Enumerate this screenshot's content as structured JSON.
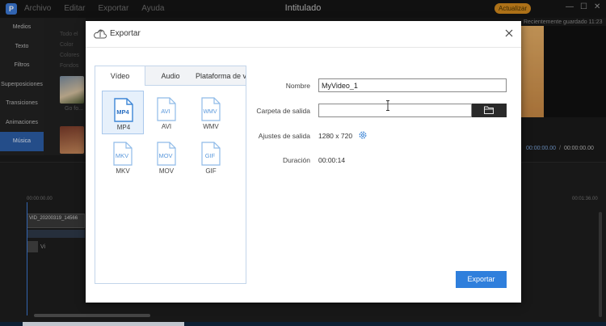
{
  "app": {
    "title": "Intitulado",
    "logo_letter": "P",
    "menu": [
      "Archivo",
      "Editar",
      "Exportar",
      "Ayuda"
    ],
    "upgrade_label": "Actualizar",
    "autosave": "Recientemente guardado 11:23",
    "timecode_current": "00:00:00.00",
    "timecode_sep": "/",
    "timecode_total": "00:00:00.00"
  },
  "sidebar": {
    "items": [
      {
        "label": "Medios"
      },
      {
        "label": "Texto"
      },
      {
        "label": "Filtros"
      },
      {
        "label": "Superposiciones"
      },
      {
        "label": "Transiciones"
      },
      {
        "label": "Animaciones"
      },
      {
        "label": "Música"
      }
    ],
    "media_lines": [
      "Todo el",
      "Color",
      "Colores",
      "Fondos"
    ],
    "thumb_label": "Go fo..."
  },
  "timeline": {
    "ruler_start": "00:00:00.00",
    "ruler_end": "00:01:36.00",
    "clip_name": "VID_20200319_14566",
    "track_label": "Vi"
  },
  "dialog": {
    "title": "Exportar",
    "tabs": {
      "video": "Vídeo",
      "audio": "Audio",
      "platform": "Plataforma de vídeo"
    },
    "formats": [
      {
        "label": "MP4",
        "selected": true
      },
      {
        "label": "AVI",
        "selected": false
      },
      {
        "label": "WMV",
        "selected": false
      },
      {
        "label": "MKV",
        "selected": false
      },
      {
        "label": "MOV",
        "selected": false
      },
      {
        "label": "GIF",
        "selected": false
      }
    ],
    "name": {
      "label": "Nombre",
      "value": "MyVideo_1"
    },
    "folder": {
      "label": "Carpeta de salida",
      "value": ""
    },
    "settings": {
      "label": "Ajustes de salida",
      "value": "1280 x 720"
    },
    "duration": {
      "label": "Duración",
      "value": "00:00:14"
    },
    "export_label": "Exportar"
  },
  "colors": {
    "accent": "#2f7fdc",
    "format_icon": "#3d86d6",
    "selected_bg": "#e6f0fb",
    "panel_border": "#c3d5ea",
    "sidebar_active": "#2c5ea8",
    "upgrade": "#d38a1e"
  },
  "icons": [
    "export-icon",
    "close-icon",
    "file-icon",
    "folder-icon",
    "gear-icon",
    "text-cursor-icon"
  ]
}
